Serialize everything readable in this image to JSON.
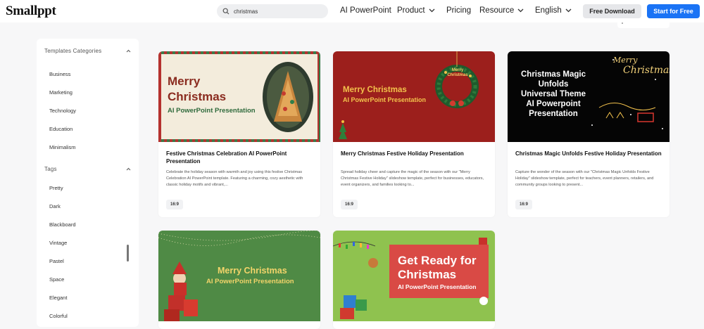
{
  "header": {
    "logo": "Smallppt",
    "search_value": "christmas",
    "nav": [
      {
        "label": "AI PowerPoint"
      },
      {
        "label": "Product"
      },
      {
        "label": "Pricing"
      },
      {
        "label": "Resource"
      },
      {
        "label": "English"
      }
    ],
    "free_download_label": "Free Download",
    "start_free_label": "Start for Free",
    "colors": {
      "primary": "#1a73f5",
      "secondary_btn": "#e6e7ea"
    }
  },
  "sidebar": {
    "categories_title": "Templates Categories",
    "categories": [
      "Business",
      "Marketing",
      "Technology",
      "Education",
      "Minimalism"
    ],
    "tags_title": "Tags",
    "tags": [
      "Pretty",
      "Dark",
      "Blackboard",
      "Vintage",
      "Pastel",
      "Space",
      "Elegant",
      "Colorful"
    ]
  },
  "cards": [
    {
      "title": "Festive Christmas Celebration AI PowerPoint Presentation",
      "description": "Celebrate the holiday season with warmth and joy using this festive Christmas Celebration AI PowerPoint template. Featuring a charming, cozy aesthetic with classic holiday motifs and vibrant,...",
      "ratio": "16:9",
      "thumb": {
        "line1": "Merry",
        "line2": "Christmas",
        "line3": "AI PowerPoint Presentation"
      }
    },
    {
      "title": "Merry Christmas Festive Holiday Presentation",
      "description": "Spread holiday cheer and capture the magic of the season with our \"Merry Christmas Festive Holiday\" slideshow template, perfect for businesses, educators, event organizers, and families looking to...",
      "ratio": "16:9",
      "thumb": {
        "line1": "Merry Christmas",
        "line2": "AI PowerPoint Presentation",
        "badge": "Merry Christmas"
      }
    },
    {
      "title": "Christmas Magic Unfolds Festive Holiday Presentation",
      "description": "Capture the wonder of the season with our \"Christmas Magic Unfolds Festive Holiday\" slideshow template, perfect for teachers, event planners, retailers, and community groups looking to present...",
      "ratio": "16:9",
      "thumb": {
        "line1": "Christmas Magic",
        "line2": "Unfolds",
        "line3": "Universal Theme",
        "line4": "AI Powerpoint",
        "line5": "Presentation",
        "script1": "Merry",
        "script2": "Christmas"
      }
    },
    {
      "thumb": {
        "line1": "Merry Christmas",
        "line2": "AI PowerPoint Presentation"
      }
    },
    {
      "thumb": {
        "line1": "Get Ready for",
        "line2": "Christmas",
        "line3": "AI PowerPoint Presentation"
      }
    }
  ]
}
